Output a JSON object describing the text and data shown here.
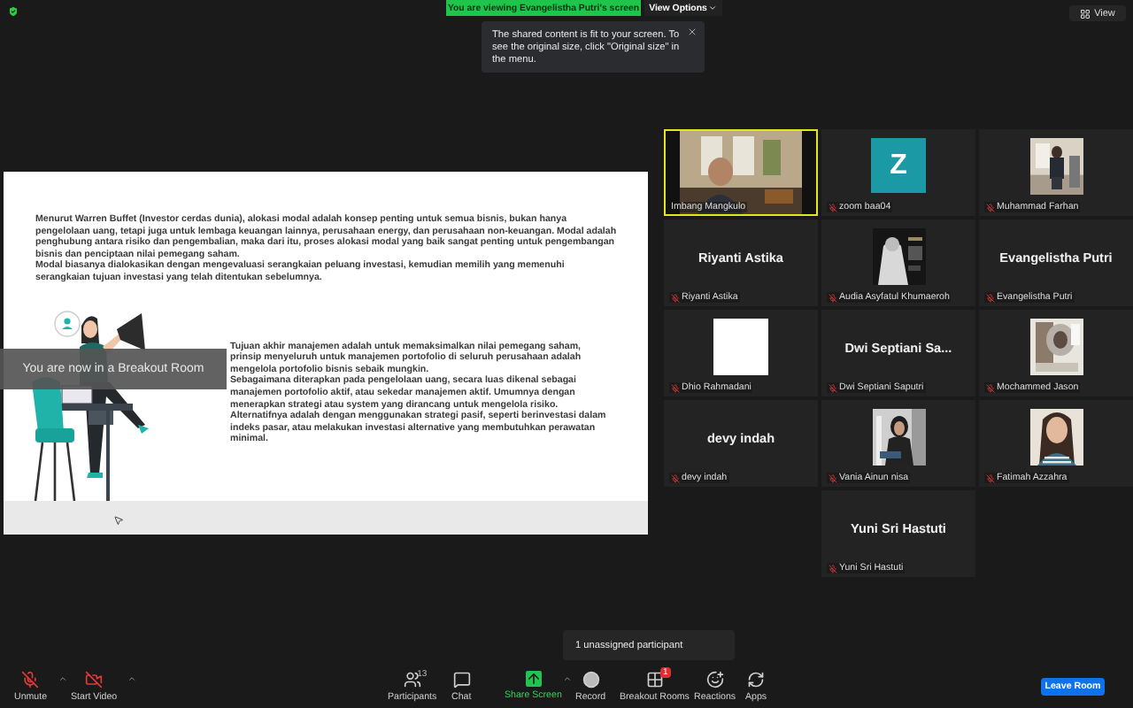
{
  "top_bar": {
    "banner": "You are viewing Evangelistha Putri's screen",
    "view_options": "View Options",
    "view_button": "View"
  },
  "notice": {
    "text": "The shared content is fit to your screen. To see the original size, click \"Original size\" in the menu."
  },
  "shared_slide": {
    "paragraph_1": "Menurut Warren Buffet (Investor cerdas dunia), alokasi modal adalah konsep penting untuk semua bisnis, bukan hanya pengelolaan uang, tetapi juga untuk lembaga keuangan lainnya, perusahaan energy, dan perusahaan non-keuangan. Modal adalah penghubung antara risiko dan pengembalian, maka dari itu, proses alokasi modal yang baik sangat penting untuk pengembangan bisnis dan penciptaan nilai pemegang saham.",
    "paragraph_2": "Modal biasanya dialokasikan dengan mengevaluasi serangkaian peluang investasi, kemudian memilih yang memenuhi serangkaian tujuan investasi yang telah ditentukan sebelumnya.",
    "paragraph_3": "Tujuan akhir manajemen adalah untuk memaksimalkan nilai pemegang saham, prinsip menyeluruh untuk manajemen portofolio di seluruh perusahaan adalah mengelola portofolio bisnis sebaik mungkin.",
    "paragraph_4": "Sebagaimana diterapkan pada pengelolaan uang, secara luas dikenal sebagai manajemen portofolio aktif, atau sekedar manajemen aktif. Umumnya dengan menerapkan strategi atau system yang dirancang untuk mengelola risiko. Alternatifnya adalah dengan menggunakan strategi pasif, seperti berinvestasi dalam indeks pasar, atau melakukan investasi alternative yang membutuhkan perawatan minimal."
  },
  "breakout_banner": "You are now in a Breakout Room",
  "participants": [
    {
      "name": "Imbang Mangkulo",
      "kind": "video",
      "muted": false,
      "speaking": true
    },
    {
      "name": "zoom baa04",
      "kind": "avatar",
      "letter": "Z",
      "muted": true,
      "speaking": false
    },
    {
      "name": "Muhammad Farhan",
      "muted": true,
      "speaking": false
    },
    {
      "name": "Riyanti Astika",
      "kind": "name",
      "display": "Riyanti Astika",
      "muted": true,
      "speaking": false
    },
    {
      "name": "Audia Asyfatul Khumaeroh",
      "muted": true,
      "speaking": false
    },
    {
      "name": "Evangelistha Putri",
      "kind": "name",
      "display": "Evangelistha Putri",
      "muted": true,
      "speaking": false
    },
    {
      "name": "Dhio Rahmadani",
      "kind": "blank",
      "muted": true,
      "speaking": false
    },
    {
      "name": "Dwi Septiani Saputri",
      "kind": "name",
      "display": "Dwi Septiani Sa...",
      "muted": true,
      "speaking": false
    },
    {
      "name": "Mochammed Jason",
      "muted": true,
      "speaking": false
    },
    {
      "name": "devy indah",
      "kind": "name",
      "display": "devy indah",
      "muted": true,
      "speaking": false
    },
    {
      "name": "Vania Ainun nisa",
      "muted": true,
      "speaking": false
    },
    {
      "name": "Fatimah Azzahra",
      "muted": true,
      "speaking": false
    },
    {
      "name": "Yuni Sri Hastuti",
      "kind": "name",
      "display": "Yuni Sri Hastuti",
      "muted": true,
      "speaking": false
    }
  ],
  "unassigned_tooltip": "1 unassigned participant",
  "toolbar": {
    "left": [
      {
        "label": "Unmute"
      },
      {
        "label": "Start Video"
      }
    ],
    "center": [
      {
        "label": "Participants",
        "count": "13"
      },
      {
        "label": "Chat"
      },
      {
        "label": "Share Screen",
        "caret": true
      },
      {
        "label": "Record"
      },
      {
        "label": "Breakout Rooms",
        "badge": "1"
      },
      {
        "label": "Reactions"
      },
      {
        "label": "Apps"
      }
    ],
    "leave": "Leave Room"
  }
}
